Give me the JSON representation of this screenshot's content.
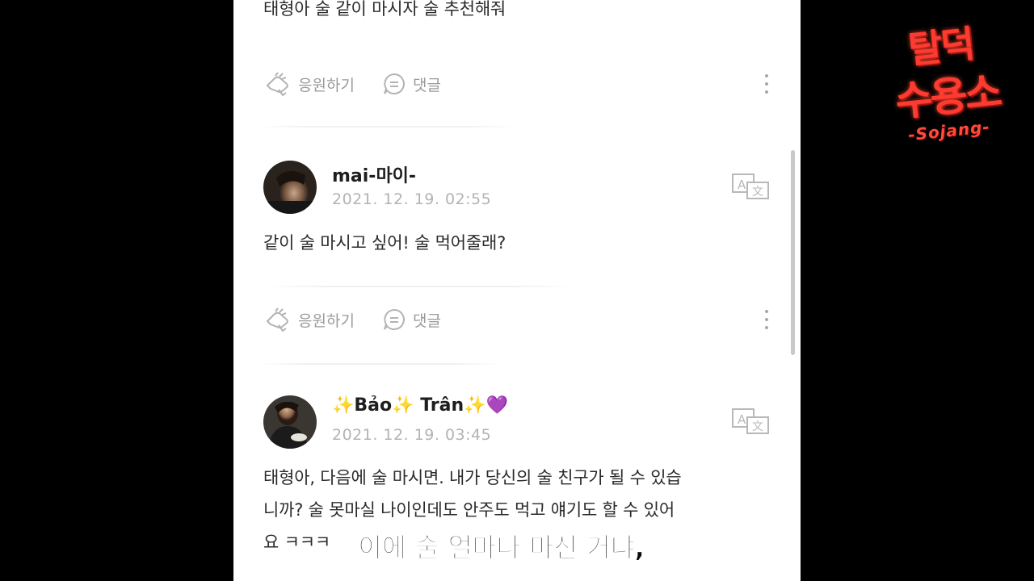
{
  "posts": [
    {
      "text": "태형아 술 같이 마시자 술 추천해줘"
    },
    {
      "author": "mai-마이-",
      "timestamp": "2021. 12. 19. 02:55",
      "text": "같이 술 마시고 싶어! 술 먹어줄래?"
    },
    {
      "author_prefix": "✨",
      "author_name1": "Bảo",
      "author_mid": "✨",
      "author_name2": "Trân",
      "author_suffix": "✨",
      "author_heart": "💜",
      "timestamp": "2021. 12. 19. 03:45",
      "text_lines": [
        "태형아, 다음에 술 마시면.  내가 당신의 술 친구가 될 수 있습",
        "니까?  술 못마실 나이인데도 안주도 먹고 얘기도 할 수 있어",
        "요 ㅋㅋㅋ"
      ]
    }
  ],
  "actions": {
    "cheer_label": "응원하기",
    "comment_label": "댓글"
  },
  "subtitle": "이에 술 얼마나 마신 거냐,",
  "logo": {
    "line1": "탈덕",
    "line2": "수용소",
    "line3": "-Sojang-"
  },
  "colors": {
    "logo_red": "#ff3b30",
    "muted_gray": "#9a9a9a",
    "heart_purple": "#8a3ffc"
  }
}
